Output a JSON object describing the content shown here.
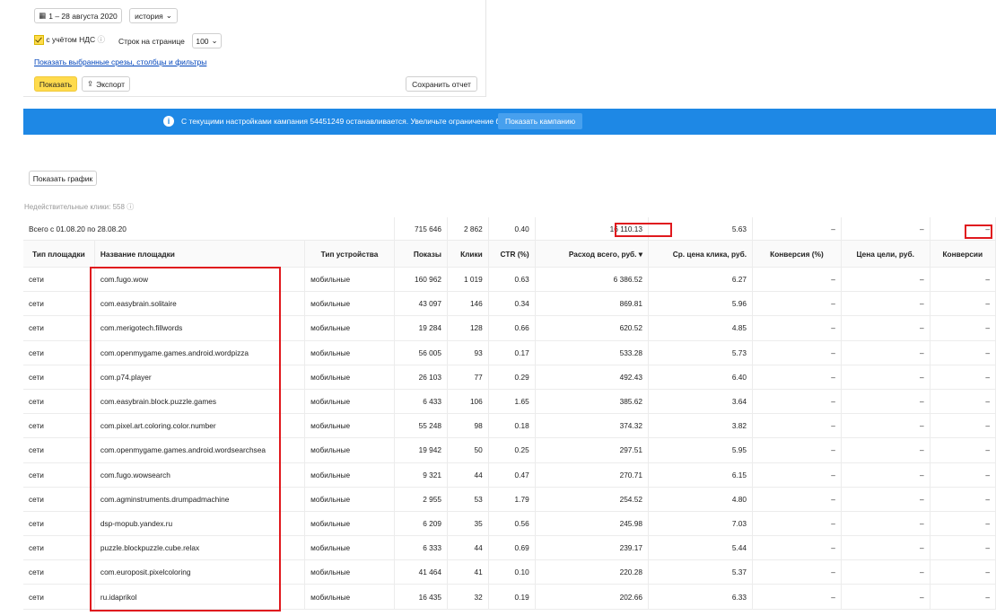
{
  "toolbar": {
    "date_range": "1 – 28 августа 2020",
    "history_label": "история",
    "vat_label": "с учётом НДС",
    "rows_per_page_label": "Строк на странице",
    "rows_per_page_value": "100",
    "show_selected_link": "Показать выбранные срезы, столбцы и фильтры",
    "show_button": "Показать",
    "export_button": "Экспорт",
    "save_report_button": "Сохранить отчет"
  },
  "banner": {
    "message": "С текущими настройками кампания 54451249 останавливается. Увеличьте ограничение бюджета.",
    "button": "Показать кампанию",
    "color": "#1e88e5"
  },
  "chart_button": "Показать график",
  "invalid_clicks": "Недействительные клики: 558",
  "totals": {
    "label": "Всего с 01.08.20 по 28.08.20",
    "shows": "715 646",
    "clicks": "2 862",
    "ctr": "0.40",
    "spend": "16 110.13",
    "cpc": "5.63",
    "conv_rate": "–",
    "goal_price": "–",
    "conversions": "–"
  },
  "columns": [
    "Тип площадки",
    "Название площадки",
    "Тип устройства",
    "Показы",
    "Клики",
    "CTR (%)",
    "Расход всего, руб. ▾",
    "Ср. цена клика, руб.",
    "Конверсия (%)",
    "Цена цели, руб.",
    "Конверсии"
  ],
  "rows": [
    {
      "type": "сети",
      "name": "com.fugo.wow",
      "device": "мобильные",
      "shows": "160 962",
      "clicks": "1 019",
      "ctr": "0.63",
      "spend": "6 386.52",
      "cpc": "6.27",
      "conv_rate": "–",
      "goal_price": "–",
      "conversions": "–"
    },
    {
      "type": "сети",
      "name": "com.easybrain.solitaire",
      "device": "мобильные",
      "shows": "43 097",
      "clicks": "146",
      "ctr": "0.34",
      "spend": "869.81",
      "cpc": "5.96",
      "conv_rate": "–",
      "goal_price": "–",
      "conversions": "–"
    },
    {
      "type": "сети",
      "name": "com.merigotech.fillwords",
      "device": "мобильные",
      "shows": "19 284",
      "clicks": "128",
      "ctr": "0.66",
      "spend": "620.52",
      "cpc": "4.85",
      "conv_rate": "–",
      "goal_price": "–",
      "conversions": "–"
    },
    {
      "type": "сети",
      "name": "com.openmygame.games.android.wordpizza",
      "device": "мобильные",
      "shows": "56 005",
      "clicks": "93",
      "ctr": "0.17",
      "spend": "533.28",
      "cpc": "5.73",
      "conv_rate": "–",
      "goal_price": "–",
      "conversions": "–"
    },
    {
      "type": "сети",
      "name": "com.p74.player",
      "device": "мобильные",
      "shows": "26 103",
      "clicks": "77",
      "ctr": "0.29",
      "spend": "492.43",
      "cpc": "6.40",
      "conv_rate": "–",
      "goal_price": "–",
      "conversions": "–"
    },
    {
      "type": "сети",
      "name": "com.easybrain.block.puzzle.games",
      "device": "мобильные",
      "shows": "6 433",
      "clicks": "106",
      "ctr": "1.65",
      "spend": "385.62",
      "cpc": "3.64",
      "conv_rate": "–",
      "goal_price": "–",
      "conversions": "–"
    },
    {
      "type": "сети",
      "name": "com.pixel.art.coloring.color.number",
      "device": "мобильные",
      "shows": "55 248",
      "clicks": "98",
      "ctr": "0.18",
      "spend": "374.32",
      "cpc": "3.82",
      "conv_rate": "–",
      "goal_price": "–",
      "conversions": "–"
    },
    {
      "type": "сети",
      "name": "com.openmygame.games.android.wordsearchsea",
      "device": "мобильные",
      "shows": "19 942",
      "clicks": "50",
      "ctr": "0.25",
      "spend": "297.51",
      "cpc": "5.95",
      "conv_rate": "–",
      "goal_price": "–",
      "conversions": "–"
    },
    {
      "type": "сети",
      "name": "com.fugo.wowsearch",
      "device": "мобильные",
      "shows": "9 321",
      "clicks": "44",
      "ctr": "0.47",
      "spend": "270.71",
      "cpc": "6.15",
      "conv_rate": "–",
      "goal_price": "–",
      "conversions": "–"
    },
    {
      "type": "сети",
      "name": "com.agminstruments.drumpadmachine",
      "device": "мобильные",
      "shows": "2 955",
      "clicks": "53",
      "ctr": "1.79",
      "spend": "254.52",
      "cpc": "4.80",
      "conv_rate": "–",
      "goal_price": "–",
      "conversions": "–"
    },
    {
      "type": "сети",
      "name": "dsp-mopub.yandex.ru",
      "device": "мобильные",
      "shows": "6 209",
      "clicks": "35",
      "ctr": "0.56",
      "spend": "245.98",
      "cpc": "7.03",
      "conv_rate": "–",
      "goal_price": "–",
      "conversions": "–"
    },
    {
      "type": "сети",
      "name": "puzzle.blockpuzzle.cube.relax",
      "device": "мобильные",
      "shows": "6 333",
      "clicks": "44",
      "ctr": "0.69",
      "spend": "239.17",
      "cpc": "5.44",
      "conv_rate": "–",
      "goal_price": "–",
      "conversions": "–"
    },
    {
      "type": "сети",
      "name": "com.europosit.pixelcoloring",
      "device": "мобильные",
      "shows": "41 464",
      "clicks": "41",
      "ctr": "0.10",
      "spend": "220.28",
      "cpc": "5.37",
      "conv_rate": "–",
      "goal_price": "–",
      "conversions": "–"
    },
    {
      "type": "сети",
      "name": "ru.idaprikol",
      "device": "мобильные",
      "shows": "16 435",
      "clicks": "32",
      "ctr": "0.19",
      "spend": "202.66",
      "cpc": "6.33",
      "conv_rate": "–",
      "goal_price": "–",
      "conversions": "–"
    }
  ]
}
